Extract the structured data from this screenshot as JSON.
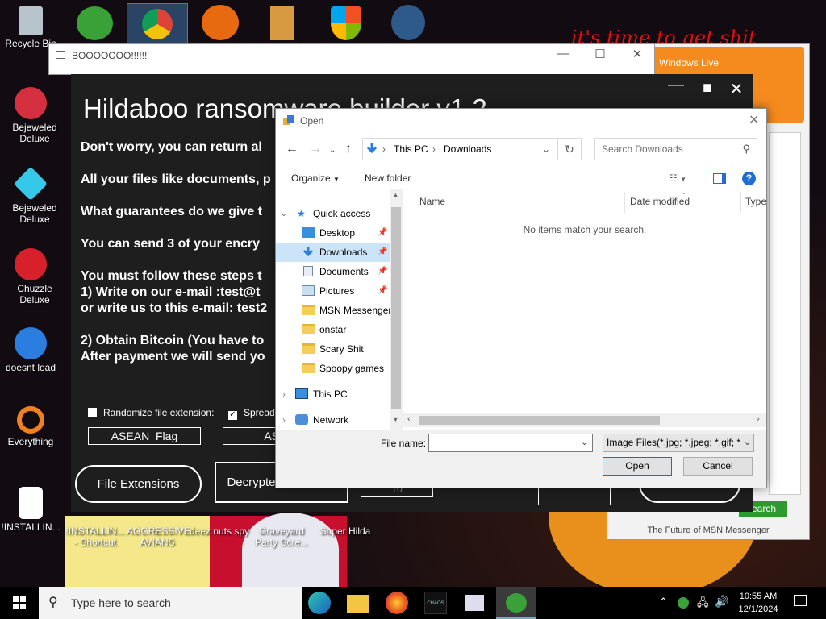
{
  "desktop": {
    "icons": [
      {
        "label": "Recycle Bin"
      },
      {
        "label": "Bejeweled Deluxe"
      },
      {
        "label": "Bejeweled Deluxe"
      },
      {
        "label": "Chuzzle Deluxe"
      },
      {
        "label": "doesnt load"
      },
      {
        "label": "Everything"
      },
      {
        "label": "!INSTALLIN..."
      },
      {
        "label": "!INSTALLIN... - Shortcut"
      },
      {
        "label": "AGGRESSIVE AVIANS"
      },
      {
        "label": "deez nuts spy"
      },
      {
        "label": "Graveyard Party Scre..."
      },
      {
        "label": "Super Hilda"
      }
    ],
    "wallpaper_text": "it's time to get shit"
  },
  "boo_window": {
    "title": "BOOOOOOO!!!!!!"
  },
  "ransom_app": {
    "title": "Hildaboo ransomware builder v1.2",
    "lines": [
      "Don't worry, you can return al",
      "All your files like documents, p",
      "What guarantees do we give t",
      "You can send 3 of your encry",
      "You must follow these steps t",
      "1) Write on our e-mail :test@t",
      "or write us to this e-mail: test2",
      "2) Obtain Bitcoin (You have to",
      "After payment we will send yo"
    ],
    "checkbox_randomize": "Randomize file extension:",
    "checkbox_spread": "Spread",
    "field_flag": "ASEAN_Flag",
    "field_2": "ASEA",
    "field_3": "10",
    "btn_file_extensions": "File Extensions",
    "btn_decrypter": "Decrypter & Options"
  },
  "msn_window": {
    "brand": "Windows Live",
    "footer": "The Future of MSN Messenger",
    "search_btn": "earch"
  },
  "open_dialog": {
    "title": "Open",
    "address": {
      "root": "This PC",
      "current": "Downloads"
    },
    "search_placeholder": "Search Downloads",
    "toolbar": {
      "organize": "Organize",
      "new_folder": "New folder"
    },
    "tree": [
      {
        "label": "Quick access"
      },
      {
        "label": "Desktop"
      },
      {
        "label": "Downloads"
      },
      {
        "label": "Documents"
      },
      {
        "label": "Pictures"
      },
      {
        "label": "MSN Messenger"
      },
      {
        "label": "onstar"
      },
      {
        "label": "Scary Shit"
      },
      {
        "label": "Spoopy games"
      },
      {
        "label": "This PC"
      },
      {
        "label": "Network"
      }
    ],
    "columns": {
      "name": "Name",
      "date": "Date modified",
      "type": "Type"
    },
    "empty_message": "No items match your search.",
    "file_name_label": "File name:",
    "file_name_value": "",
    "file_type": "Image Files(*.jpg; *.jpeg; *.gif; *",
    "open_btn": "Open",
    "cancel_btn": "Cancel"
  },
  "taskbar": {
    "search_placeholder": "Type here to search",
    "time": "10:55 AM",
    "date": "12/1/2024"
  }
}
